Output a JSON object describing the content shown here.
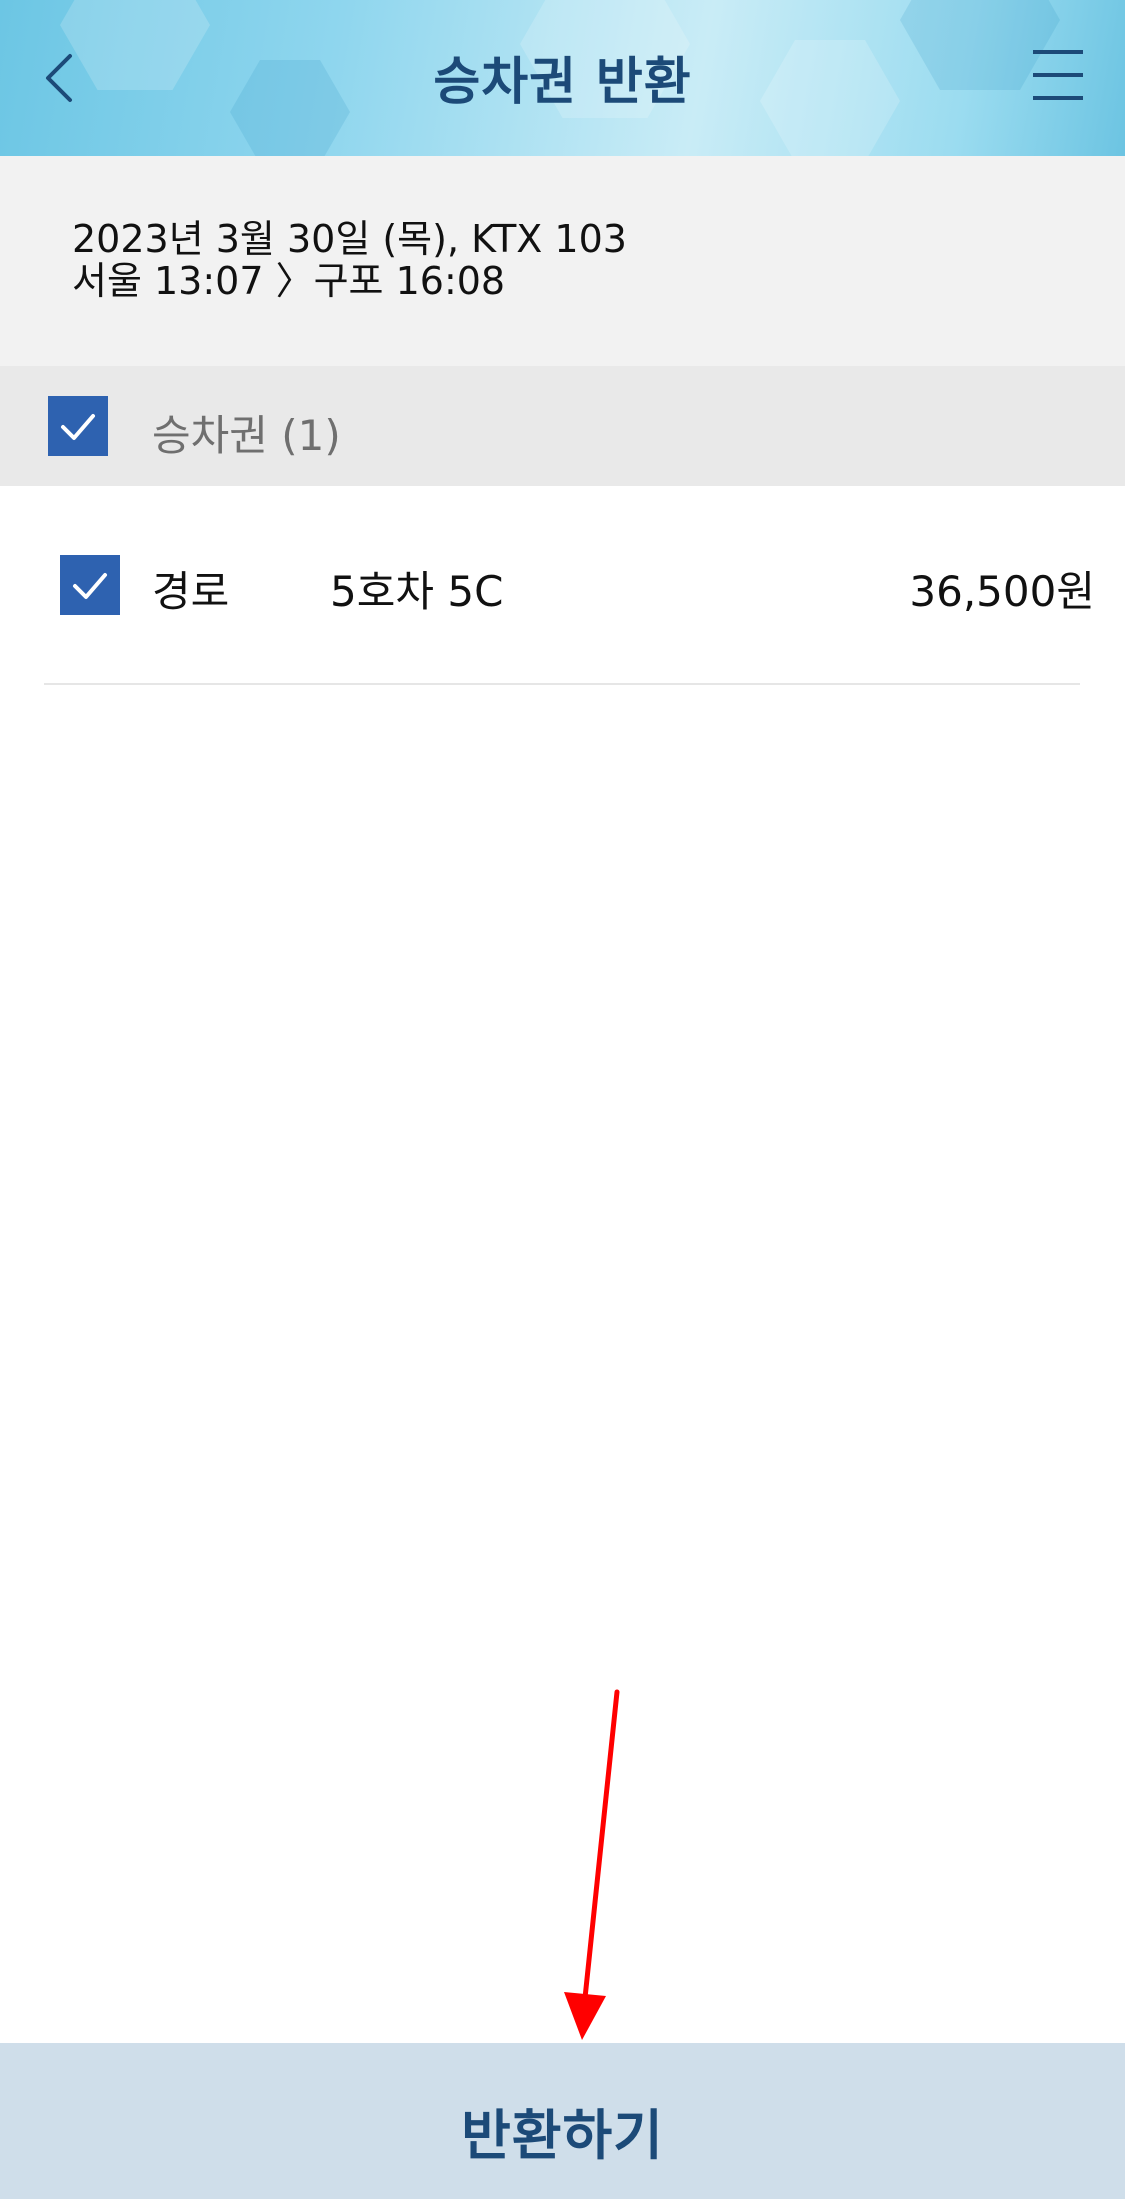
{
  "header": {
    "title": "승차권 반환",
    "back_icon": "chevron-left-icon",
    "menu_icon": "hamburger-menu-icon"
  },
  "trip": {
    "date_train": "2023년 3월 30일 (목), KTX 103",
    "route": "서울 13:07 〉구포 16:08"
  },
  "ticket_group": {
    "label": "승차권 (1)",
    "checked": true
  },
  "tickets": [
    {
      "type": "경로",
      "seat": "5호차 5C",
      "price": "36,500원",
      "checked": true
    }
  ],
  "action": {
    "return_label": "반환하기"
  },
  "colors": {
    "header_text": "#1c4a78",
    "checkbox": "#2e62b0",
    "button_bg": "#cfdeea",
    "annotation_arrow": "#ff0000"
  }
}
